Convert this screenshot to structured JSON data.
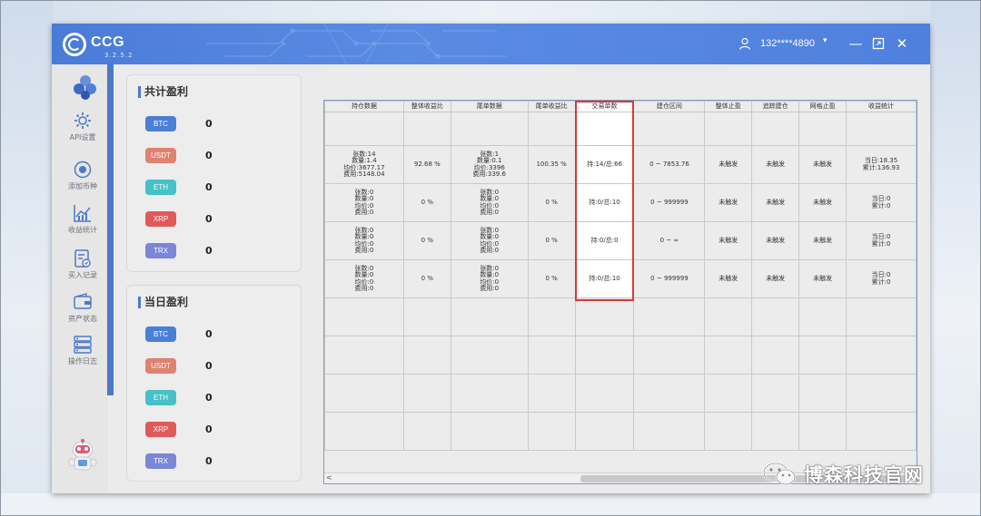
{
  "app": {
    "brand": "CCG",
    "version": "3.2.5.2",
    "user": "132****4890"
  },
  "sidebar": {
    "items": [
      {
        "label": "API设置",
        "icon": "gear-icon"
      },
      {
        "label": "添加币种",
        "icon": "coin-add-icon"
      },
      {
        "label": "收益统计",
        "icon": "chart-icon"
      },
      {
        "label": "买入记录",
        "icon": "record-icon"
      },
      {
        "label": "资产状态",
        "icon": "wallet-icon"
      },
      {
        "label": "操作日志",
        "icon": "log-icon"
      }
    ]
  },
  "total_profit": {
    "title": "共计盈利",
    "coins": [
      {
        "name": "BTC",
        "value": "0",
        "color": "#4a7fd6"
      },
      {
        "name": "USDT",
        "value": "0",
        "color": "#e0826f"
      },
      {
        "name": "ETH",
        "value": "0",
        "color": "#45c1c7"
      },
      {
        "name": "XRP",
        "value": "0",
        "color": "#e05a5a"
      },
      {
        "name": "TRX",
        "value": "0",
        "color": "#7a86d6"
      }
    ]
  },
  "daily_profit": {
    "title": "当日盈利",
    "coins": [
      {
        "name": "BTC",
        "value": "0",
        "color": "#4a7fd6"
      },
      {
        "name": "USDT",
        "value": "0",
        "color": "#e0826f"
      },
      {
        "name": "ETH",
        "value": "0",
        "color": "#45c1c7"
      },
      {
        "name": "XRP",
        "value": "0",
        "color": "#e05a5a"
      },
      {
        "name": "TRX",
        "value": "0",
        "color": "#7a86d6"
      }
    ]
  },
  "table": {
    "headers": [
      "持仓数据",
      "整体收益比",
      "尾单数据",
      "尾单收益比",
      "交易单数",
      "建仓区间",
      "整体止盈",
      "追踪建仓",
      "网格止盈",
      "收益统计"
    ],
    "rows": [
      {
        "position": [
          "张数:14",
          "数量:1.4",
          "均价:3677.17",
          "费用:5148.04"
        ],
        "ratio": "92.68 %",
        "tail": [
          "张数:1",
          "数量:0.1",
          "均价:3396",
          "费用:339.6"
        ],
        "tail_ratio": "100.35 %",
        "trades": "持:14/总:66",
        "range": "0 ~ 7853.76",
        "tp": "未触发",
        "track": "未触发",
        "grid": "未触发",
        "stats": [
          "当日:18.35",
          "累计:136.93"
        ]
      },
      {
        "position": [
          "张数:0",
          "数量:0",
          "均价:0",
          "费用:0"
        ],
        "ratio": "0 %",
        "tail": [
          "张数:0",
          "数量:0",
          "均价:0",
          "费用:0"
        ],
        "tail_ratio": "0 %",
        "trades": "持:0/总:10",
        "range": "0 ~ 999999",
        "tp": "未触发",
        "track": "未触发",
        "grid": "未触发",
        "stats": [
          "当日:0",
          "累计:0"
        ]
      },
      {
        "position": [
          "张数:0",
          "数量:0",
          "均价:0",
          "费用:0"
        ],
        "ratio": "0 %",
        "tail": [
          "张数:0",
          "数量:0",
          "均价:0",
          "费用:0"
        ],
        "tail_ratio": "0 %",
        "trades": "持:0/总:0",
        "range": "0 ~ ∞",
        "tp": "未触发",
        "track": "未触发",
        "grid": "未触发",
        "stats": [
          "当日:0",
          "累计:0"
        ]
      },
      {
        "position": [
          "张数:0",
          "数量:0",
          "均价:0",
          "费用:0"
        ],
        "ratio": "0 %",
        "tail": [
          "张数:0",
          "数量:0",
          "均价:0",
          "费用:0"
        ],
        "tail_ratio": "0 %",
        "trades": "持:0/总:10",
        "range": "0 ~ 999999",
        "tp": "未触发",
        "track": "未触发",
        "grid": "未触发",
        "stats": [
          "当日:0",
          "累计:0"
        ]
      }
    ],
    "scroll_left_arrow": "<"
  },
  "watermark": "博森科技官网"
}
